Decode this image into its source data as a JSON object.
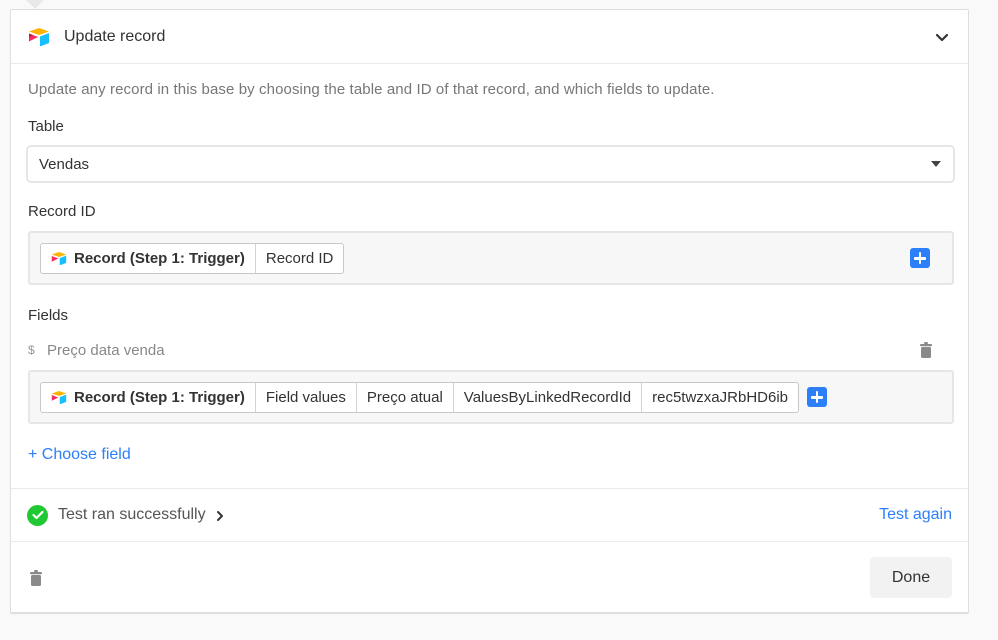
{
  "header": {
    "title": "Update record",
    "logo_icon": "airtable-logo-icon",
    "collapse_icon": "chevron-down-icon"
  },
  "description": "Update any record in this base by choosing the table and ID of that record, and which fields to update.",
  "table": {
    "label": "Table",
    "selected": "Vendas"
  },
  "record_id": {
    "label": "Record ID",
    "tokens": [
      "Record (Step 1: Trigger)",
      "Record ID"
    ]
  },
  "fields": {
    "label": "Fields",
    "items": [
      {
        "name": "Preço data venda",
        "type_icon": "$",
        "tokens": [
          "Record (Step 1: Trigger)",
          "Field values",
          "Preço atual",
          "ValuesByLinkedRecordId",
          "rec5twzxaJRbHD6ib"
        ]
      }
    ],
    "choose_label": "+ Choose field"
  },
  "test": {
    "status": "Test ran successfully",
    "again_label": "Test again"
  },
  "footer": {
    "done_label": "Done"
  },
  "colors": {
    "accent": "#2d7ff9",
    "success": "#20c933"
  }
}
